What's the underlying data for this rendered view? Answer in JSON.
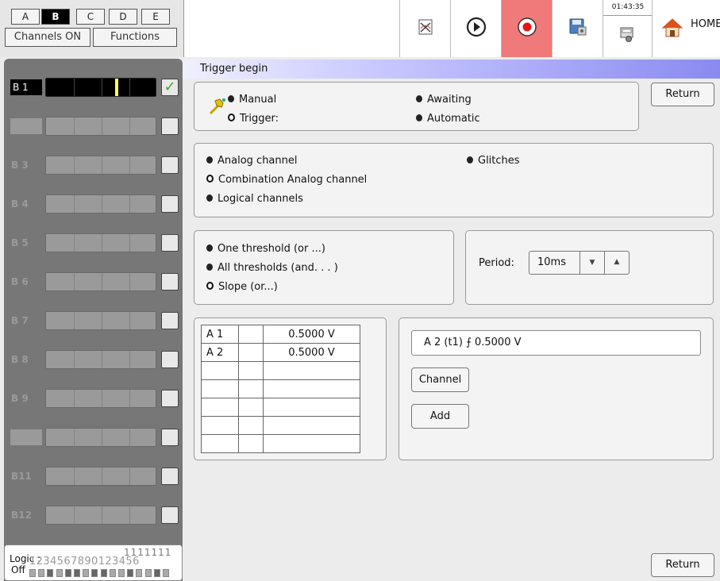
{
  "tabs": {
    "bank_tabs": [
      "A",
      "B",
      "C",
      "D",
      "E"
    ],
    "active_bank": "B",
    "channels_on_label": "Channels ON",
    "functions_label": "Functions"
  },
  "toolbar": {
    "clock": "01:43:35",
    "home_label": "HOME",
    "icons": [
      "waveform-icon",
      "play-icon",
      "record-icon",
      "save-disk-icon",
      "settings-icon",
      "home-icon"
    ]
  },
  "channels": [
    {
      "label": "B 1",
      "active": true,
      "checked": true
    },
    {
      "label": "",
      "active": false,
      "checked": false
    },
    {
      "label": "B 3",
      "active": false,
      "checked": false
    },
    {
      "label": "B 4",
      "active": false,
      "checked": false
    },
    {
      "label": "B 5",
      "active": false,
      "checked": false
    },
    {
      "label": "B 6",
      "active": false,
      "checked": false
    },
    {
      "label": "B 7",
      "active": false,
      "checked": false
    },
    {
      "label": "B 8",
      "active": false,
      "checked": false
    },
    {
      "label": "B 9",
      "active": false,
      "checked": false
    },
    {
      "label": "",
      "active": false,
      "checked": false
    },
    {
      "label": "B11",
      "active": false,
      "checked": false
    },
    {
      "label": "B12",
      "active": false,
      "checked": false
    }
  ],
  "logic": {
    "title": "Logic :",
    "state": "Off",
    "tens_row": "1111111",
    "units_row": "1234567890123456",
    "bits": [
      1,
      1,
      0,
      1,
      0,
      0,
      1,
      0,
      0,
      1,
      1,
      0,
      1,
      1,
      0,
      1
    ]
  },
  "trigger": {
    "title": "Trigger begin",
    "return_label": "Return",
    "bottom_return_label": "Return",
    "mode": {
      "manual": "Manual",
      "trigger": "Trigger:",
      "awaiting": "Awaiting",
      "automatic": "Automatic"
    },
    "source": {
      "analog": "Analog channel",
      "combination": "Combination Analog channel",
      "logical": "Logical channels",
      "glitches": "Glitches"
    },
    "threshold": {
      "one": "One threshold (or ...)",
      "all": "All thresholds  (and. . . )",
      "slope": "Slope (or...)"
    },
    "period": {
      "label": "Period:",
      "value": "10ms"
    },
    "table": [
      {
        "channel": "A 1",
        "value": "0.5000 V"
      },
      {
        "channel": "A 2",
        "value": "0.5000 V"
      },
      {
        "channel": "",
        "value": ""
      },
      {
        "channel": "",
        "value": ""
      },
      {
        "channel": "",
        "value": ""
      },
      {
        "channel": "",
        "value": ""
      },
      {
        "channel": "",
        "value": ""
      }
    ],
    "expression": "A 2 (t1) ⨍ 0.5000 V",
    "channel_button": "Channel",
    "add_button": "Add"
  }
}
